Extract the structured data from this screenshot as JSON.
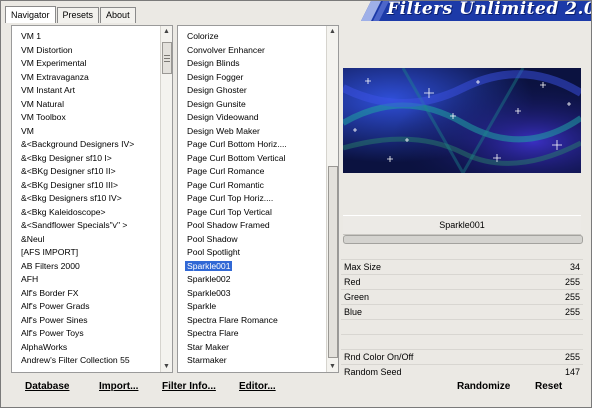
{
  "tabs": [
    "Navigator",
    "Presets",
    "About"
  ],
  "banner": {
    "title": "Filters Unlimited 2.0"
  },
  "categories": {
    "items": [
      "VM 1",
      "VM Distortion",
      "VM Experimental",
      "VM Extravaganza",
      "VM Instant Art",
      "VM Natural",
      "VM Toolbox",
      "VM",
      "&<Background Designers IV>",
      "&<Bkg Designer sf10 I>",
      "&<BKg Designer sf10 II>",
      "&<BKg Designer sf10 III>",
      "&<Bkg Designers sf10 IV>",
      "&<Bkg Kaleidoscope>",
      "&<Sandflower Specials\"v\" >",
      "&Neul",
      "[AFS IMPORT]",
      "AB Filters 2000",
      "AFH",
      "Alf's Border FX",
      "Alf's Power Grads",
      "Alf's Power Sines",
      "Alf's Power Toys",
      "AlphaWorks",
      "Andrew's Filter Collection 55"
    ],
    "selected_index": -1
  },
  "filters": {
    "items": [
      "Colorize",
      "Convolver Enhancer",
      "Design Blinds",
      "Design Fogger",
      "Design Ghoster",
      "Design Gunsite",
      "Design Videowand",
      "Design Web Maker",
      "Page Curl Bottom Horiz....",
      "Page Curl Bottom Vertical",
      "Page Curl Romance",
      "Page Curl Romantic",
      "Page Curl Top Horiz....",
      "Page Curl Top Vertical",
      "Pool Shadow Framed",
      "Pool Shadow",
      "Pool Spotlight",
      "Sparkle001",
      "Sparkle002",
      "Sparkle003",
      "Sparkle",
      "Spectra Flare Romance",
      "Spectra Flare",
      "Star Maker",
      "Starmaker"
    ],
    "selected_index": 17
  },
  "preview": {
    "filter_name": "Sparkle001"
  },
  "parameters": [
    {
      "name": "Max Size",
      "value": "34"
    },
    {
      "name": "Red",
      "value": "255"
    },
    {
      "name": "Green",
      "value": "255"
    },
    {
      "name": "Blue",
      "value": "255"
    },
    {
      "name": "",
      "value": ""
    },
    {
      "name": "",
      "value": ""
    },
    {
      "name": "Rnd Color On/Off",
      "value": "255"
    },
    {
      "name": "Random Seed",
      "value": "147"
    }
  ],
  "buttons": {
    "database": "Database",
    "import": "Import...",
    "filter_info": "Filter Info...",
    "editor": "Editor...",
    "randomize": "Randomize",
    "reset": "Reset"
  },
  "colors": {
    "selection": "#3168d5",
    "banner_bg": "#1c3aa8",
    "preview_bg": "#0b1240"
  }
}
